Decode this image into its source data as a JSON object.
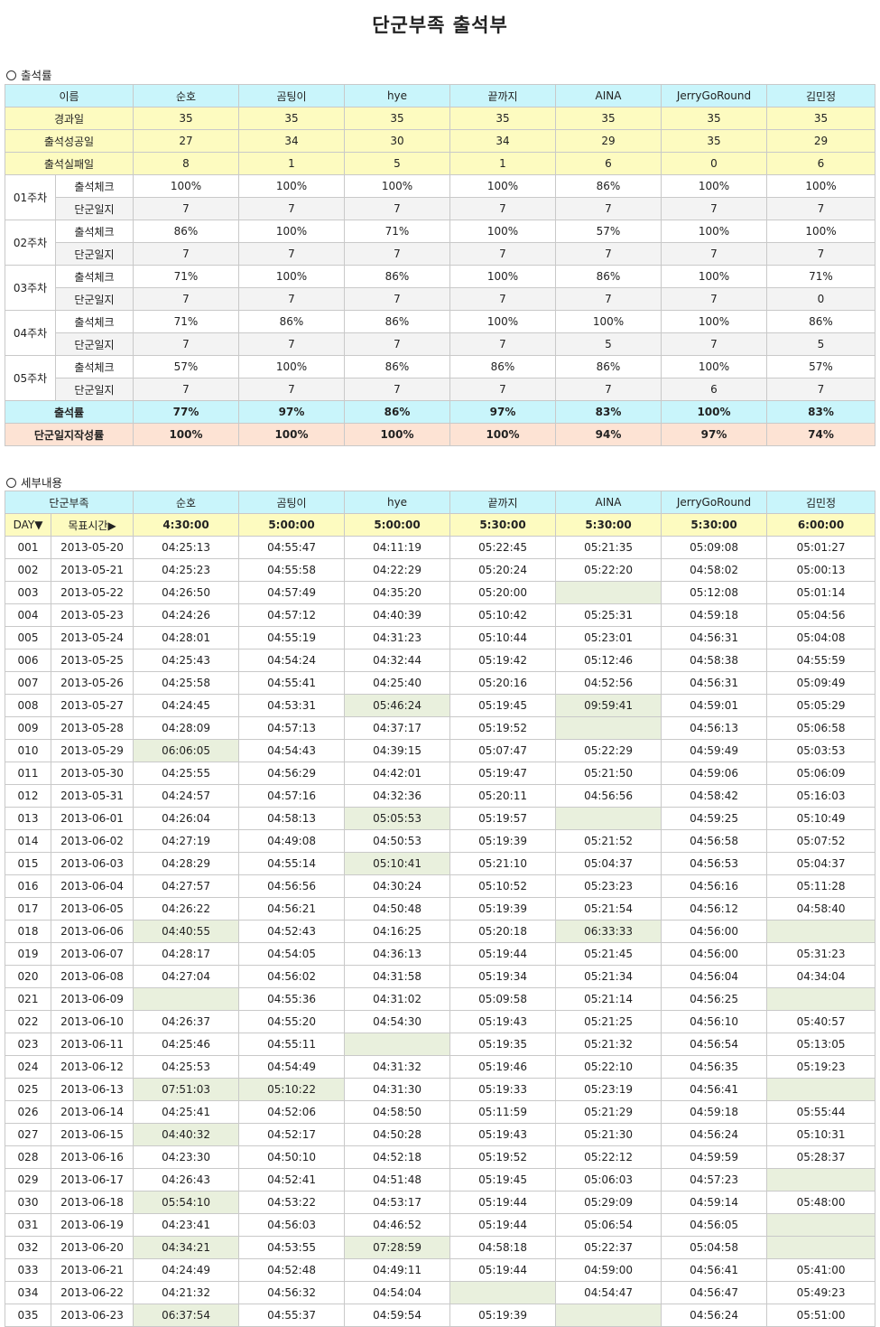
{
  "title": "단군부족 출석부",
  "sections": {
    "summary": "출석률",
    "detail": "세부내용"
  },
  "summary": {
    "header": [
      "이름",
      "순호",
      "곰팅이",
      "hye",
      "끝까지",
      "AINA",
      "JerryGoRound",
      "김민정"
    ],
    "stats": [
      {
        "label": "경과일",
        "values": [
          "35",
          "35",
          "35",
          "35",
          "35",
          "35",
          "35"
        ]
      },
      {
        "label": "출석성공일",
        "values": [
          "27",
          "34",
          "30",
          "34",
          "29",
          "35",
          "29"
        ]
      },
      {
        "label": "출석실패일",
        "values": [
          "8",
          "1",
          "5",
          "1",
          "6",
          "0",
          "6"
        ]
      }
    ],
    "weeks": [
      {
        "week": "01주차",
        "check_label": "출석체크",
        "check": [
          "100%",
          "100%",
          "100%",
          "100%",
          "86%",
          "100%",
          "100%"
        ],
        "diary_label": "단군일지",
        "diary": [
          "7",
          "7",
          "7",
          "7",
          "7",
          "7",
          "7"
        ]
      },
      {
        "week": "02주차",
        "check_label": "출석체크",
        "check": [
          "86%",
          "100%",
          "71%",
          "100%",
          "57%",
          "100%",
          "100%"
        ],
        "diary_label": "단군일지",
        "diary": [
          "7",
          "7",
          "7",
          "7",
          "7",
          "7",
          "7"
        ]
      },
      {
        "week": "03주차",
        "check_label": "출석체크",
        "check": [
          "71%",
          "100%",
          "86%",
          "100%",
          "86%",
          "100%",
          "71%"
        ],
        "diary_label": "단군일지",
        "diary": [
          "7",
          "7",
          "7",
          "7",
          "7",
          "7",
          "0"
        ]
      },
      {
        "week": "04주차",
        "check_label": "출석체크",
        "check": [
          "71%",
          "86%",
          "86%",
          "100%",
          "100%",
          "100%",
          "86%"
        ],
        "diary_label": "단군일지",
        "diary": [
          "7",
          "7",
          "7",
          "7",
          "5",
          "7",
          "5"
        ]
      },
      {
        "week": "05주차",
        "check_label": "출석체크",
        "check": [
          "57%",
          "100%",
          "86%",
          "86%",
          "86%",
          "100%",
          "57%"
        ],
        "diary_label": "단군일지",
        "diary": [
          "7",
          "7",
          "7",
          "7",
          "7",
          "6",
          "7"
        ]
      }
    ],
    "attendance_rate": {
      "label": "출석률",
      "values": [
        "77%",
        "97%",
        "86%",
        "97%",
        "83%",
        "100%",
        "83%"
      ]
    },
    "diary_rate": {
      "label": "단군일지작성률",
      "values": [
        "100%",
        "100%",
        "100%",
        "100%",
        "94%",
        "97%",
        "74%"
      ]
    }
  },
  "detail": {
    "header": [
      "단군부족",
      "순호",
      "곰팅이",
      "hye",
      "끝까지",
      "AINA",
      "JerryGoRound",
      "김민정"
    ],
    "target_row": {
      "day_label": "DAY▼",
      "target_label": "목표시간▶",
      "targets": [
        "4:30:00",
        "5:00:00",
        "5:00:00",
        "5:30:00",
        "5:30:00",
        "5:30:00",
        "6:00:00"
      ]
    },
    "rows": [
      {
        "day": "001",
        "date": "2013-05-20",
        "times": [
          "04:25:13",
          "04:55:47",
          "04:11:19",
          "05:22:45",
          "05:21:35",
          "05:09:08",
          "05:01:27"
        ]
      },
      {
        "day": "002",
        "date": "2013-05-21",
        "times": [
          "04:25:23",
          "04:55:58",
          "04:22:29",
          "05:20:24",
          "05:22:20",
          "04:58:02",
          "05:00:13"
        ]
      },
      {
        "day": "003",
        "date": "2013-05-22",
        "times": [
          "04:26:50",
          "04:57:49",
          "04:35:20",
          "05:20:00",
          "",
          "05:12:08",
          "05:01:14"
        ]
      },
      {
        "day": "004",
        "date": "2013-05-23",
        "times": [
          "04:24:26",
          "04:57:12",
          "04:40:39",
          "05:10:42",
          "05:25:31",
          "04:59:18",
          "05:04:56"
        ]
      },
      {
        "day": "005",
        "date": "2013-05-24",
        "times": [
          "04:28:01",
          "04:55:19",
          "04:31:23",
          "05:10:44",
          "05:23:01",
          "04:56:31",
          "05:04:08"
        ]
      },
      {
        "day": "006",
        "date": "2013-05-25",
        "times": [
          "04:25:43",
          "04:54:24",
          "04:32:44",
          "05:19:42",
          "05:12:46",
          "04:58:38",
          "04:55:59"
        ]
      },
      {
        "day": "007",
        "date": "2013-05-26",
        "times": [
          "04:25:58",
          "04:55:41",
          "04:25:40",
          "05:20:16",
          "04:52:56",
          "04:56:31",
          "05:09:49"
        ]
      },
      {
        "day": "008",
        "date": "2013-05-27",
        "times": [
          "04:24:45",
          "04:53:31",
          "05:46:24",
          "05:19:45",
          "09:59:41",
          "04:59:01",
          "05:05:29"
        ]
      },
      {
        "day": "009",
        "date": "2013-05-28",
        "times": [
          "04:28:09",
          "04:57:13",
          "04:37:17",
          "05:19:52",
          "",
          "04:56:13",
          "05:06:58"
        ]
      },
      {
        "day": "010",
        "date": "2013-05-29",
        "times": [
          "06:06:05",
          "04:54:43",
          "04:39:15",
          "05:07:47",
          "05:22:29",
          "04:59:49",
          "05:03:53"
        ]
      },
      {
        "day": "011",
        "date": "2013-05-30",
        "times": [
          "04:25:55",
          "04:56:29",
          "04:42:01",
          "05:19:47",
          "05:21:50",
          "04:59:06",
          "05:06:09"
        ]
      },
      {
        "day": "012",
        "date": "2013-05-31",
        "times": [
          "04:24:57",
          "04:57:16",
          "04:32:36",
          "05:20:11",
          "04:56:56",
          "04:58:42",
          "05:16:03"
        ]
      },
      {
        "day": "013",
        "date": "2013-06-01",
        "times": [
          "04:26:04",
          "04:58:13",
          "05:05:53",
          "05:19:57",
          "",
          "04:59:25",
          "05:10:49"
        ]
      },
      {
        "day": "014",
        "date": "2013-06-02",
        "times": [
          "04:27:19",
          "04:49:08",
          "04:50:53",
          "05:19:39",
          "05:21:52",
          "04:56:58",
          "05:07:52"
        ]
      },
      {
        "day": "015",
        "date": "2013-06-03",
        "times": [
          "04:28:29",
          "04:55:14",
          "05:10:41",
          "05:21:10",
          "05:04:37",
          "04:56:53",
          "05:04:37"
        ]
      },
      {
        "day": "016",
        "date": "2013-06-04",
        "times": [
          "04:27:57",
          "04:56:56",
          "04:30:24",
          "05:10:52",
          "05:23:23",
          "04:56:16",
          "05:11:28"
        ]
      },
      {
        "day": "017",
        "date": "2013-06-05",
        "times": [
          "04:26:22",
          "04:56:21",
          "04:50:48",
          "05:19:39",
          "05:21:54",
          "04:56:12",
          "04:58:40"
        ]
      },
      {
        "day": "018",
        "date": "2013-06-06",
        "times": [
          "04:40:55",
          "04:52:43",
          "04:16:25",
          "05:20:18",
          "06:33:33",
          "04:56:00",
          ""
        ]
      },
      {
        "day": "019",
        "date": "2013-06-07",
        "times": [
          "04:28:17",
          "04:54:05",
          "04:36:13",
          "05:19:44",
          "05:21:45",
          "04:56:00",
          "05:31:23"
        ]
      },
      {
        "day": "020",
        "date": "2013-06-08",
        "times": [
          "04:27:04",
          "04:56:02",
          "04:31:58",
          "05:19:34",
          "05:21:34",
          "04:56:04",
          "04:34:04"
        ]
      },
      {
        "day": "021",
        "date": "2013-06-09",
        "times": [
          "",
          "04:55:36",
          "04:31:02",
          "05:09:58",
          "05:21:14",
          "04:56:25",
          ""
        ]
      },
      {
        "day": "022",
        "date": "2013-06-10",
        "times": [
          "04:26:37",
          "04:55:20",
          "04:54:30",
          "05:19:43",
          "05:21:25",
          "04:56:10",
          "05:40:57"
        ]
      },
      {
        "day": "023",
        "date": "2013-06-11",
        "times": [
          "04:25:46",
          "04:55:11",
          "",
          "05:19:35",
          "05:21:32",
          "04:56:54",
          "05:13:05"
        ]
      },
      {
        "day": "024",
        "date": "2013-06-12",
        "times": [
          "04:25:53",
          "04:54:49",
          "04:31:32",
          "05:19:46",
          "05:22:10",
          "04:56:35",
          "05:19:23"
        ]
      },
      {
        "day": "025",
        "date": "2013-06-13",
        "times": [
          "07:51:03",
          "05:10:22",
          "04:31:30",
          "05:19:33",
          "05:23:19",
          "04:56:41",
          ""
        ]
      },
      {
        "day": "026",
        "date": "2013-06-14",
        "times": [
          "04:25:41",
          "04:52:06",
          "04:58:50",
          "05:11:59",
          "05:21:29",
          "04:59:18",
          "05:55:44"
        ]
      },
      {
        "day": "027",
        "date": "2013-06-15",
        "times": [
          "04:40:32",
          "04:52:17",
          "04:50:28",
          "05:19:43",
          "05:21:30",
          "04:56:24",
          "05:10:31"
        ]
      },
      {
        "day": "028",
        "date": "2013-06-16",
        "times": [
          "04:23:30",
          "04:50:10",
          "04:52:18",
          "05:19:52",
          "05:22:12",
          "04:59:59",
          "05:28:37"
        ]
      },
      {
        "day": "029",
        "date": "2013-06-17",
        "times": [
          "04:26:43",
          "04:52:41",
          "04:51:48",
          "05:19:45",
          "05:06:03",
          "04:57:23",
          ""
        ]
      },
      {
        "day": "030",
        "date": "2013-06-18",
        "times": [
          "05:54:10",
          "04:53:22",
          "04:53:17",
          "05:19:44",
          "05:29:09",
          "04:59:14",
          "05:48:00"
        ]
      },
      {
        "day": "031",
        "date": "2013-06-19",
        "times": [
          "04:23:41",
          "04:56:03",
          "04:46:52",
          "05:19:44",
          "05:06:54",
          "04:56:05",
          ""
        ]
      },
      {
        "day": "032",
        "date": "2013-06-20",
        "times": [
          "04:34:21",
          "04:53:55",
          "07:28:59",
          "04:58:18",
          "05:22:37",
          "05:04:58",
          ""
        ]
      },
      {
        "day": "033",
        "date": "2013-06-21",
        "times": [
          "04:24:49",
          "04:52:48",
          "04:49:11",
          "05:19:44",
          "04:59:00",
          "04:56:41",
          "05:41:00"
        ]
      },
      {
        "day": "034",
        "date": "2013-06-22",
        "times": [
          "04:21:32",
          "04:56:32",
          "04:54:04",
          "",
          "04:54:47",
          "04:56:47",
          "05:49:23"
        ]
      },
      {
        "day": "035",
        "date": "2013-06-23",
        "times": [
          "06:37:54",
          "04:55:37",
          "04:59:54",
          "05:19:39",
          "",
          "04:56:24",
          "05:51:00"
        ]
      }
    ]
  },
  "colors": {
    "header": "#c9f5fb",
    "target": "#fdfbc0",
    "diary_rate": "#fde3d4",
    "failed_cell": "#e9f0dd",
    "diary_row": "#f3f3f3"
  }
}
